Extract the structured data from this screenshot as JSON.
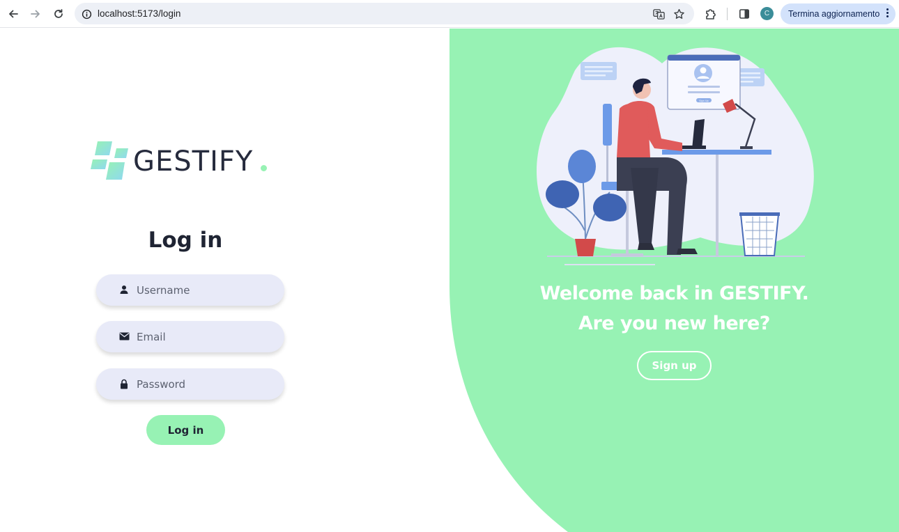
{
  "browser": {
    "url": "localhost:5173/login",
    "avatar_initial": "C",
    "update_label": "Termina aggiornamento",
    "icons": [
      "back-icon",
      "forward-icon",
      "reload-icon",
      "site-info-icon",
      "translate-icon",
      "bookmark-star-icon",
      "extensions-icon",
      "side-panel-icon",
      "menu-dots-icon"
    ]
  },
  "brand": {
    "name": "GESTIFY",
    "accent_color": "#97f2b4",
    "logo_colors": [
      "#97f2b4",
      "#8fd8f0"
    ]
  },
  "login": {
    "title": "Log in",
    "username_placeholder": "Username",
    "email_placeholder": "Email",
    "password_placeholder": "Password",
    "submit_label": "Log in"
  },
  "welcome": {
    "line1": "Welcome back in GESTIFY.",
    "line2": "Are you new here?",
    "signup_label": "Sign up"
  },
  "illustration": {
    "screen_button_text": "Sign Up"
  }
}
